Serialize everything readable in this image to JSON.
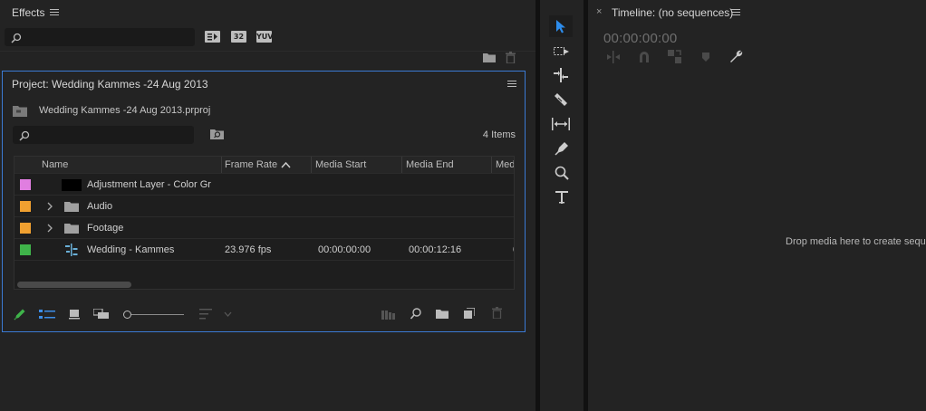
{
  "effects": {
    "title": "Effects",
    "search": {
      "value": "",
      "placeholder": ""
    },
    "badges": [
      "32",
      "YUV"
    ]
  },
  "project": {
    "title": "Project: Wedding Kammes -24 Aug 2013",
    "file_name": "Wedding Kammes -24 Aug 2013.prproj",
    "search": {
      "value": "",
      "placeholder": ""
    },
    "item_count": "4 Items",
    "columns": [
      "Name",
      "Frame Rate",
      "Media Start",
      "Media End",
      "Med"
    ],
    "rows": [
      {
        "color": "#e07ee0",
        "name": "Adjustment Layer - Color Gr",
        "type": "adjustment",
        "frame_rate": "",
        "media_start": "",
        "media_end": ""
      },
      {
        "color": "#f0a030",
        "name": "Audio",
        "type": "bin",
        "frame_rate": "",
        "media_start": "",
        "media_end": ""
      },
      {
        "color": "#f0a030",
        "name": "Footage",
        "type": "bin",
        "frame_rate": "",
        "media_start": "",
        "media_end": ""
      },
      {
        "color": "#3fb44a",
        "name": "Wedding - Kammes",
        "type": "sequence",
        "frame_rate": "23.976 fps",
        "media_start": "00:00:00:00",
        "media_end": "00:00:12:16"
      }
    ]
  },
  "tools": [
    "selection-tool",
    "track-select-tool",
    "ripple-edit-tool",
    "razor-tool",
    "slip-tool",
    "pen-tool",
    "hand-zoom-tool",
    "type-tool"
  ],
  "timeline": {
    "title": "Timeline: (no sequences)",
    "timecode": "00:00:00:00",
    "drop_message": "Drop media here to create sequ"
  },
  "colors": {
    "accent": "#3b7ad4",
    "active_tool": "#2d8ceb",
    "panel_bg": "#232323"
  }
}
